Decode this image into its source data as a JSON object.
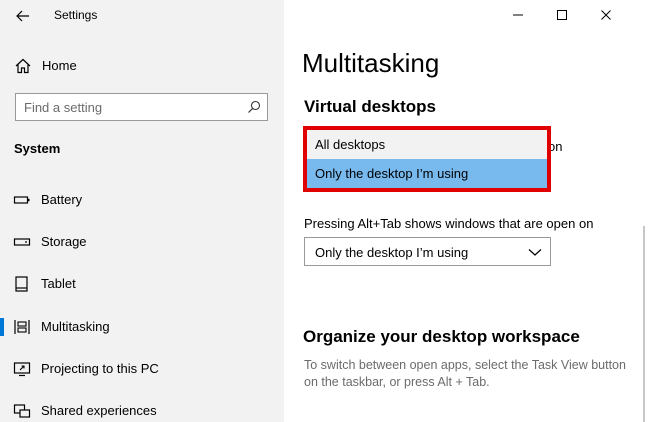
{
  "app": {
    "title": "Settings"
  },
  "nav": {
    "home": "Home",
    "search_placeholder": "Find a setting",
    "section": "System",
    "items": [
      {
        "label": "Battery",
        "icon": "battery-icon"
      },
      {
        "label": "Storage",
        "icon": "storage-icon"
      },
      {
        "label": "Tablet",
        "icon": "tablet-icon"
      },
      {
        "label": "Multitasking",
        "icon": "multitasking-icon",
        "selected": true
      },
      {
        "label": "Projecting to this PC",
        "icon": "projecting-icon"
      },
      {
        "label": "Shared experiences",
        "icon": "shared-experiences-icon"
      }
    ]
  },
  "page": {
    "title": "Multitasking",
    "virtual_desktops": {
      "heading": "Virtual desktops",
      "taskbar_label_tail": "on",
      "dropdown_options": [
        "All desktops",
        "Only the desktop I’m using"
      ],
      "dropdown_highlighted": "Only the desktop I’m using",
      "alt_tab_label": "Pressing Alt+Tab shows windows that are open on",
      "alt_tab_value": "Only the desktop I’m using"
    },
    "workspace": {
      "heading": "Organize your desktop workspace",
      "text": "To switch between open apps, select the Task View button on the taskbar, or press Alt + Tab."
    }
  },
  "colors": {
    "highlight_border": "#e00000",
    "selected_option": "#78b9ee",
    "accent": "#0078d7"
  }
}
